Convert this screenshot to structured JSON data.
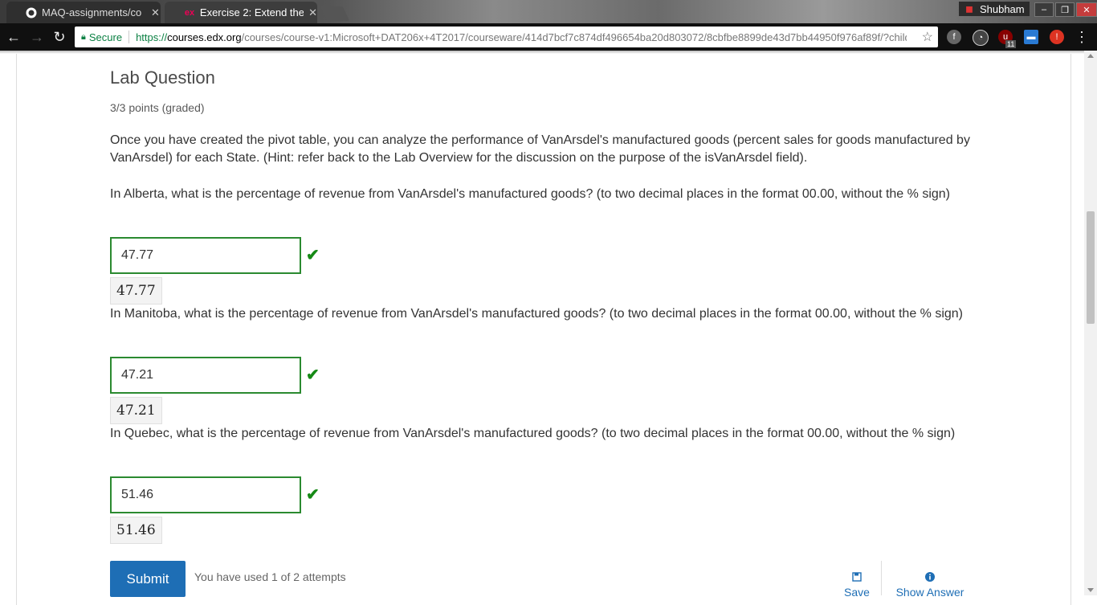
{
  "browser": {
    "tabs": [
      {
        "title": "MAQ-assignments/co",
        "icon": "github-icon"
      },
      {
        "title": "Exercise 2: Extend the",
        "icon": "edx-icon"
      }
    ],
    "profile_name": "Shubham",
    "secure_label": "Secure",
    "url_scheme": "https://",
    "url_host": "courses.edx.org",
    "url_path": "/courses/course-v1:Microsoft+DAT206x+4T2017/courseware/414d7bcf7c874df496654ba20d803072/8cbfbe8899de43d7bb44950f976af89f/?child=...",
    "extension_badge": "11"
  },
  "problem": {
    "title": "Lab Question",
    "points": "3/3 points (graded)",
    "intro": "Once you have created the pivot table, you can analyze the performance of VanArsdel's manufactured goods (percent sales for goods manufactured by VanArsdel) for each State. (Hint: refer back to the Lab Overview for the discussion on the purpose of the isVanArsdel field).",
    "questions": [
      {
        "text": "In Alberta, what is the percentage of revenue from VanArsdel's manufactured goods? (to two decimal places in the format 00.00, without the % sign)",
        "value": "47.77",
        "preview": "47.77"
      },
      {
        "text": "In Manitoba, what is the percentage of revenue from VanArsdel's manufactured goods? (to two decimal places in the format 00.00, without the % sign)",
        "value": "47.21",
        "preview": "47.21"
      },
      {
        "text": "In Quebec, what is the percentage of revenue from VanArsdel's manufactured goods? (to two decimal places in the format 00.00, without the % sign)",
        "value": "51.46",
        "preview": "51.46"
      }
    ],
    "submit_label": "Submit",
    "attempts_text": "You have used 1 of 2 attempts",
    "save_label": "Save",
    "show_answer_label": "Show Answer"
  },
  "colors": {
    "correct": "#2b8a30",
    "primary": "#1e6eb5"
  }
}
